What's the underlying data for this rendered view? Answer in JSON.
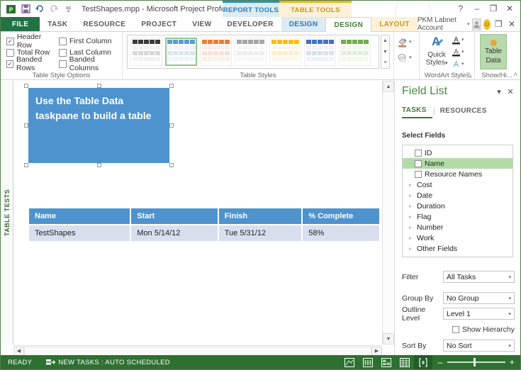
{
  "titlebar": {
    "doc_title": "TestShapes.mpp - Microsoft Project Professio...",
    "qat": [
      {
        "name": "project-logo-icon",
        "label": "P"
      },
      {
        "name": "save-icon",
        "label": "Save"
      },
      {
        "name": "undo-icon",
        "label": "Undo"
      },
      {
        "name": "redo-icon",
        "label": "Redo"
      },
      {
        "name": "customize-qat-icon",
        "label": "Customize Quick Access Toolbar"
      }
    ],
    "contextual_groups": [
      {
        "name": "report-tools",
        "label": "REPORT TOOLS",
        "color": "#2e93c9"
      },
      {
        "name": "table-tools",
        "label": "TABLE TOOLS",
        "color": "#f2b61d"
      }
    ],
    "window_controls": {
      "help": "?",
      "minimize": "–",
      "restore": "❐",
      "close": "✕",
      "doc_restore": "❐",
      "doc_close": "✕"
    }
  },
  "tabs": [
    {
      "label": "FILE",
      "kind": "file"
    },
    {
      "label": "TASK",
      "kind": "normal"
    },
    {
      "label": "RESOURCE",
      "kind": "normal"
    },
    {
      "label": "PROJECT",
      "kind": "normal"
    },
    {
      "label": "VIEW",
      "kind": "normal"
    },
    {
      "label": "DEVELOPER",
      "kind": "normal"
    },
    {
      "label": "DESIGN",
      "kind": "report-ctx"
    },
    {
      "label": "DESIGN",
      "kind": "table-ctx-active"
    },
    {
      "label": "LAYOUT",
      "kind": "table-ctx"
    }
  ],
  "account": {
    "name": "PKM Labnet Account",
    "dropdown_arrow": "▾"
  },
  "ribbon": {
    "table_style_options": {
      "group_label": "Table Style Options",
      "checkboxes": [
        {
          "label": "Header Row",
          "checked": true
        },
        {
          "label": "First Column",
          "checked": false
        },
        {
          "label": "Total Row",
          "checked": false
        },
        {
          "label": "Last Column",
          "checked": false
        },
        {
          "label": "Banded Rows",
          "checked": true
        },
        {
          "label": "Banded Columns",
          "checked": false
        }
      ],
      "check_glyph": "✓"
    },
    "table_styles": {
      "group_label": "Table Styles",
      "selected_index": 1,
      "thumbnails": [
        {
          "name": "style-black",
          "header": "#3a3a3a",
          "band": "#d9d9d9",
          "alt": "#f2f2f2"
        },
        {
          "name": "style-blue",
          "header": "#5b9bd5",
          "band": "#dce6f1",
          "alt": "#eff4fa"
        },
        {
          "name": "style-orange",
          "header": "#ed7d31",
          "band": "#fbe0d2",
          "alt": "#fdeee6"
        },
        {
          "name": "style-gray",
          "header": "#a5a5a5",
          "band": "#ededed",
          "alt": "#f7f7f7"
        },
        {
          "name": "style-gold",
          "header": "#ffc000",
          "band": "#fdeec8",
          "alt": "#fef7e4"
        },
        {
          "name": "style-steel",
          "header": "#4472c4",
          "band": "#d9e1f2",
          "alt": "#eef2fa"
        },
        {
          "name": "style-green",
          "header": "#70ad47",
          "band": "#e2efda",
          "alt": "#f2f8ee"
        }
      ],
      "scroll_up": "▲",
      "scroll_down": "▼",
      "scroll_more": "≡"
    },
    "shape_tools": {
      "fill_label": "Shape Fill",
      "effects_label": "Shape Effects",
      "arrow": "▾"
    },
    "wordart_styles": {
      "group_label": "WordArt Styles",
      "quick_styles_line1": "Quick",
      "quick_styles_line2": "Styles",
      "quick_styles_arrow": "▾",
      "text_fill_label": "Text Fill",
      "text_outline_label": "Text Outline",
      "text_effects_label": "Text Effects",
      "dialog_launcher": "⤵"
    },
    "show_hide": {
      "group_label": "Show/Hi...",
      "table_data_line1": "Table",
      "table_data_line2": "Data",
      "active": true
    },
    "collapse_arrow": "˄"
  },
  "side_tab": {
    "label": "TABLE TESTS"
  },
  "canvas": {
    "shape": {
      "text": "Use the Table Data taskpane to build a table",
      "fill_color": "#4e93ce",
      "selected": true
    },
    "table": {
      "headers": [
        "Name",
        "Start",
        "Finish",
        "% Complete"
      ],
      "rows": [
        [
          "TestShapes",
          "Mon 5/14/12",
          "Tue 5/31/12",
          "58%"
        ]
      ],
      "header_color": "#4e93ce",
      "band_color": "#d8dfee"
    }
  },
  "scrollbars": {
    "v_up": "▲",
    "v_down": "▼",
    "h_left": "◀",
    "h_right": "▶"
  },
  "field_list": {
    "title": "Field List",
    "menu_arrow": "▾",
    "close": "✕",
    "tabs": [
      {
        "label": "TASKS",
        "active": true
      },
      {
        "label": "RESOURCES",
        "active": false
      }
    ],
    "select_fields_label": "Select Fields",
    "fields": [
      {
        "label": "ID",
        "type": "checkbox",
        "checked": false,
        "selected": false
      },
      {
        "label": "Name",
        "type": "checkbox",
        "checked": false,
        "selected": true
      },
      {
        "label": "Resource Names",
        "type": "checkbox",
        "checked": false,
        "selected": false
      },
      {
        "label": "Cost",
        "type": "tree",
        "expanded": false
      },
      {
        "label": "Date",
        "type": "tree",
        "expanded": false
      },
      {
        "label": "Duration",
        "type": "tree",
        "expanded": false
      },
      {
        "label": "Flag",
        "type": "tree",
        "expanded": false
      },
      {
        "label": "Number",
        "type": "tree",
        "expanded": false
      },
      {
        "label": "Work",
        "type": "tree",
        "expanded": false
      },
      {
        "label": "Other Fields",
        "type": "tree",
        "expanded": false
      }
    ],
    "tree_arrow": "▹",
    "controls": [
      {
        "label": "Filter",
        "value": "All Tasks"
      },
      {
        "label": "Group By",
        "value": "No Group"
      },
      {
        "label": "Outline Level",
        "value": "Level 1"
      },
      {
        "label": "Sort By",
        "value": "No Sort"
      }
    ],
    "combo_arrow": "▾",
    "show_hierarchy": {
      "label": "Show Hierarchy",
      "checked": false
    }
  },
  "status_bar": {
    "ready": "READY",
    "new_tasks": "NEW TASKS : AUTO SCHEDULED",
    "view_buttons": [
      {
        "name": "gantt-chart-view-button",
        "active": false
      },
      {
        "name": "task-usage-view-button",
        "active": false
      },
      {
        "name": "team-planner-view-button",
        "active": false
      },
      {
        "name": "resource-sheet-view-button",
        "active": false
      },
      {
        "name": "report-view-button",
        "active": true
      }
    ],
    "zoom_out": "–",
    "zoom_in": "+"
  }
}
